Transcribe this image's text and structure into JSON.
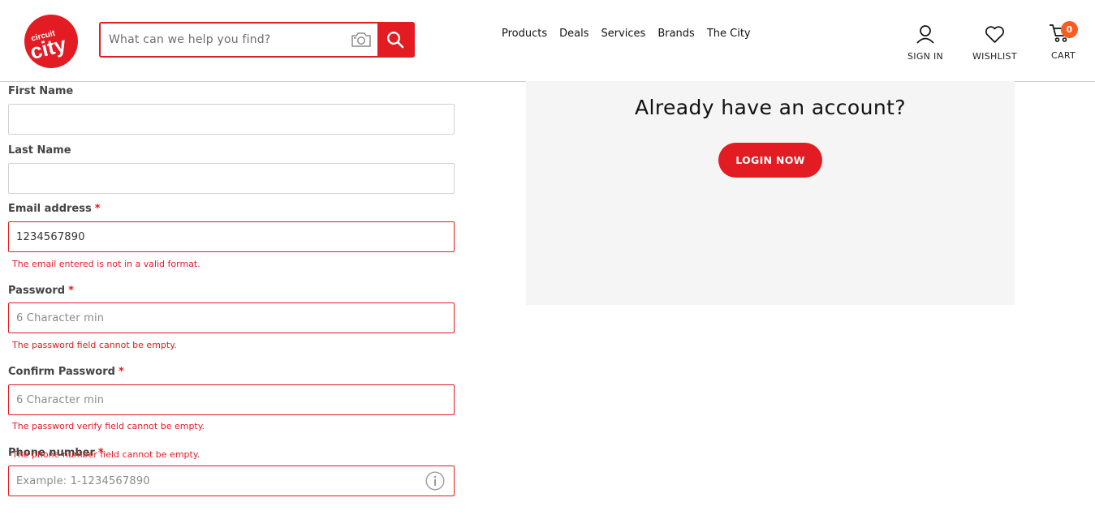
{
  "brand": {
    "logo_text_small": "circuit",
    "logo_text_large": "city",
    "accent_color": "#e31b23",
    "badge_color": "#ff5a1f"
  },
  "search": {
    "placeholder": "What can we help you find?",
    "camera_icon": "camera-icon",
    "search_icon": "magnifier-icon"
  },
  "nav": {
    "items": [
      "Products",
      "Deals",
      "Services",
      "Brands",
      "The City"
    ]
  },
  "header_actions": {
    "sign_in": "SIGN IN",
    "wishlist": "WISHLIST",
    "cart": "CART",
    "cart_count": "0"
  },
  "form": {
    "first_name": {
      "label": "First Name",
      "value": ""
    },
    "last_name": {
      "label": "Last Name",
      "value": ""
    },
    "email": {
      "label": "Email address",
      "required_mark": "*",
      "value": "1234567890",
      "error": "The email entered is not in a valid format."
    },
    "password": {
      "label": "Password",
      "required_mark": "*",
      "placeholder": "6 Character min",
      "error": "The password field cannot be empty."
    },
    "confirm_password": {
      "label": "Confirm Password",
      "required_mark": "*",
      "placeholder": "6 Character min",
      "error": "The password verify field cannot be empty."
    },
    "phone": {
      "label": "Phone number",
      "required_mark": "*",
      "placeholder": "Example: 1-1234567890",
      "error": "The phone number field cannot be empty."
    }
  },
  "login_panel": {
    "heading": "Already have an account?",
    "button": "LOGIN NOW"
  }
}
